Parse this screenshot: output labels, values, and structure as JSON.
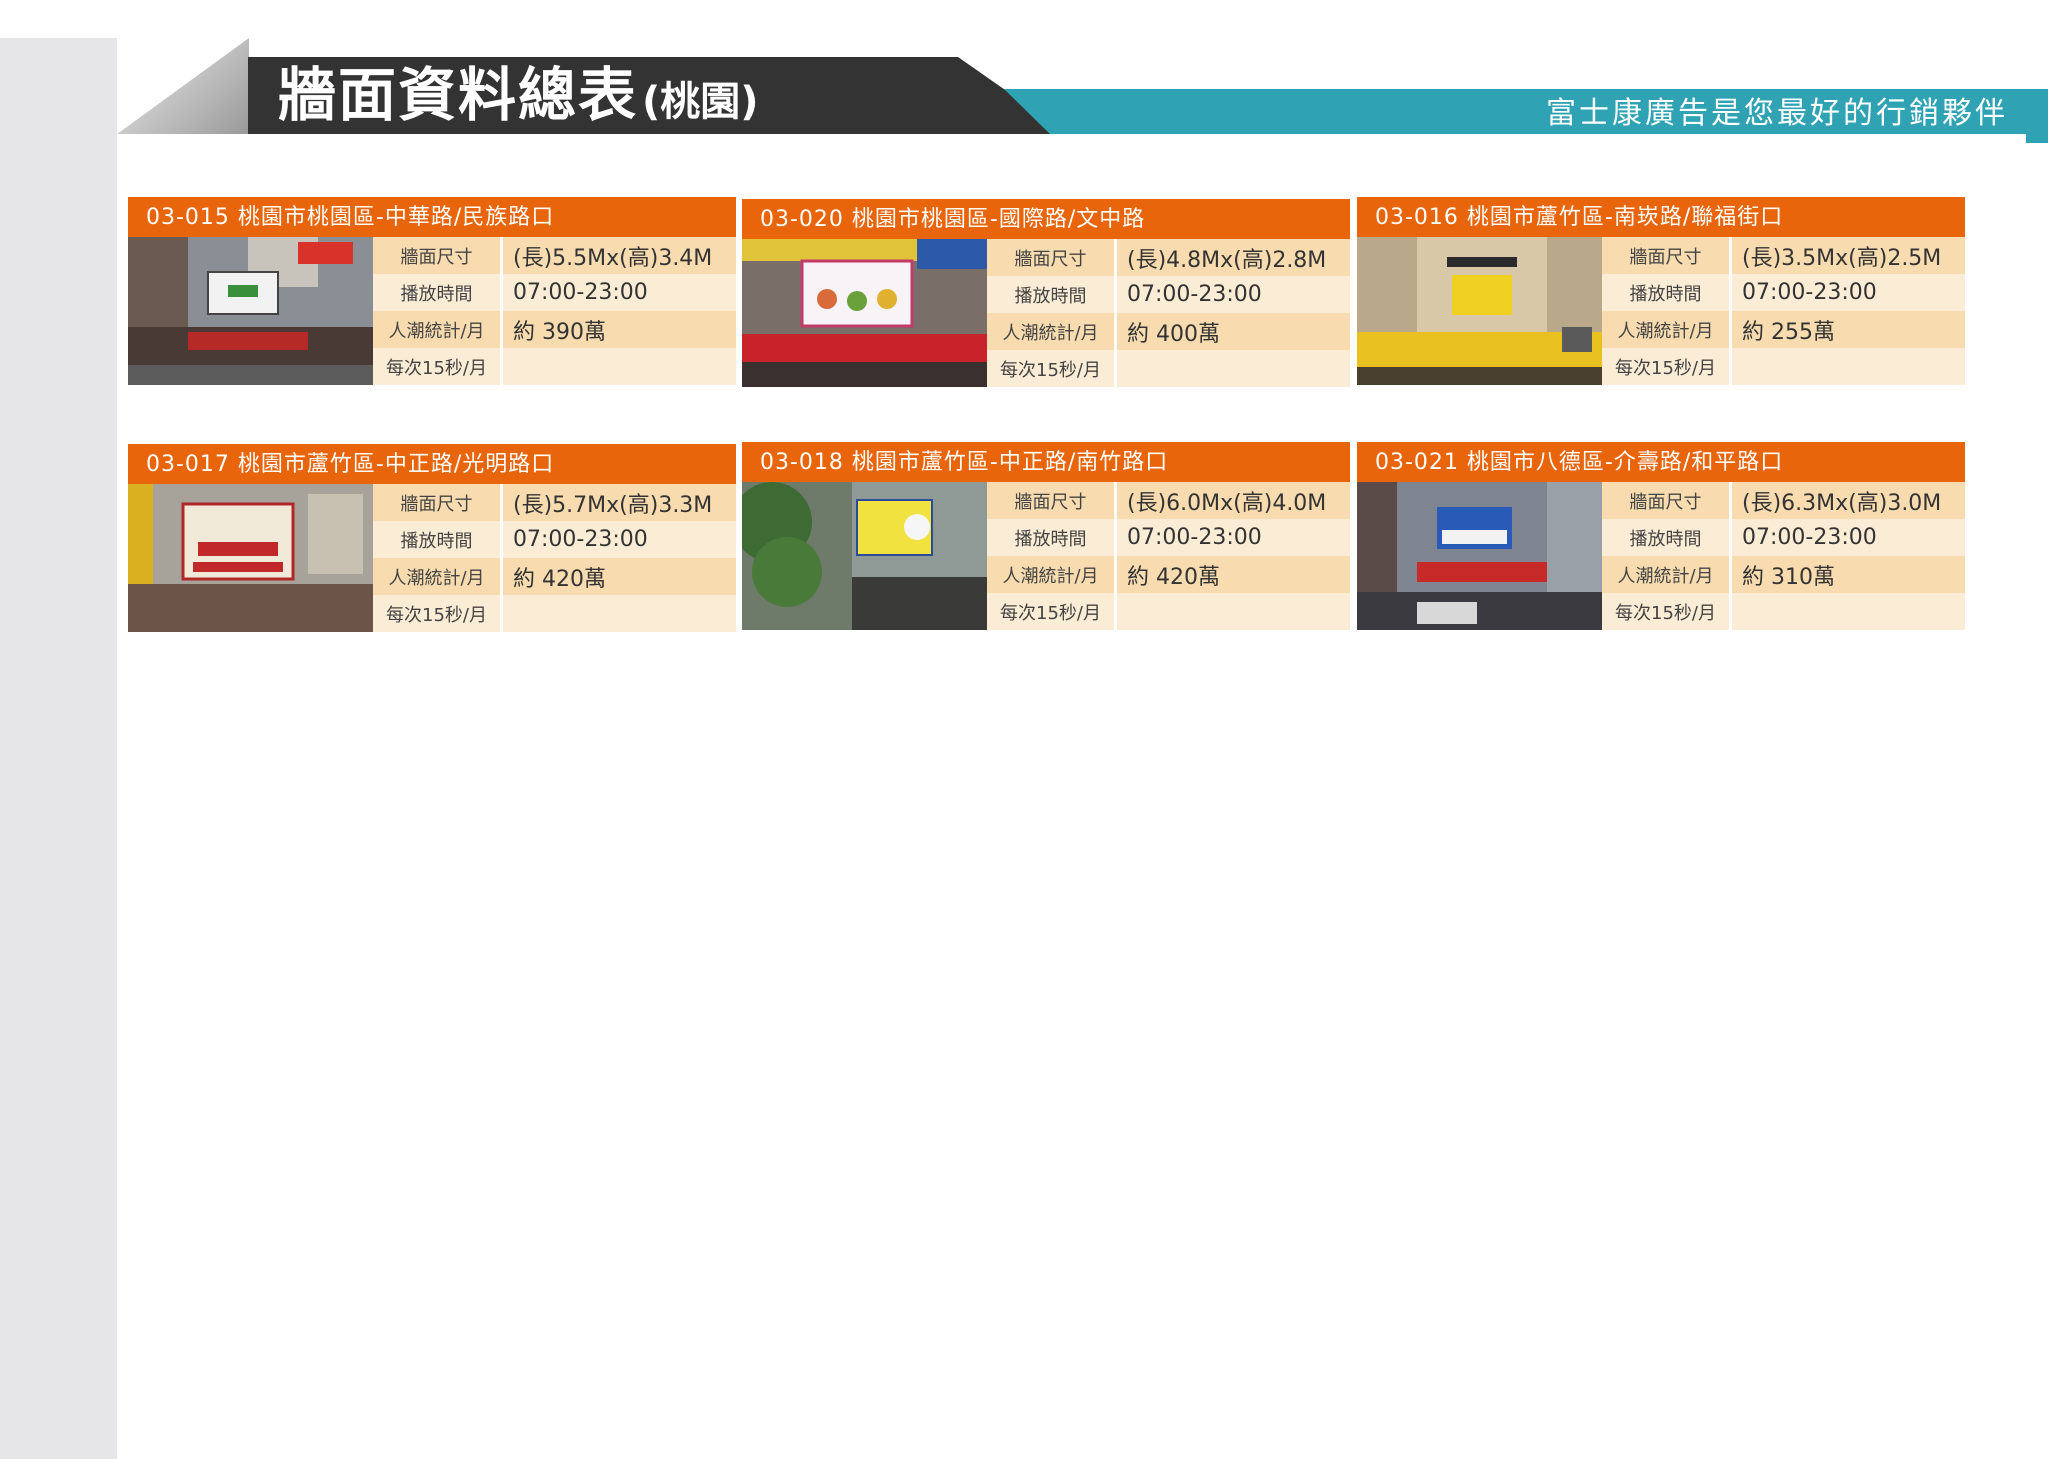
{
  "header": {
    "title": "牆面資料總表",
    "region": "(桃園)",
    "slogan": "富士康廣告是您最好的行銷夥伴"
  },
  "labels": {
    "size": "牆面尺寸",
    "hours": "播放時間",
    "traffic": "人潮統計/月",
    "per15": "每次15秒/月"
  },
  "colors": {
    "header_orange": "#e8650c",
    "title_dark": "#333333",
    "teal": "#2fa3b4",
    "row_dark": "#f8dcb0",
    "row_light": "#fbecd5"
  },
  "listings": [
    {
      "title": "03-015 桃園市桃園區-中華路/民族路口",
      "size": "(長)5.5Mx(高)3.4M",
      "hours": "07:00-23:00",
      "traffic": "約 390萬",
      "per15": ""
    },
    {
      "title": "03-020 桃園市桃園區-國際路/文中路",
      "size": "(長)4.8Mx(高)2.8M",
      "hours": "07:00-23:00",
      "traffic": "約 400萬",
      "per15": ""
    },
    {
      "title": "03-016 桃園市蘆竹區-南崁路/聯福街口",
      "size": "(長)3.5Mx(高)2.5M",
      "hours": "07:00-23:00",
      "traffic": "約 255萬",
      "per15": ""
    },
    {
      "title": "03-017 桃園市蘆竹區-中正路/光明路口",
      "size": "(長)5.7Mx(高)3.3M",
      "hours": "07:00-23:00",
      "traffic": "約 420萬",
      "per15": ""
    },
    {
      "title": "03-018 桃園市蘆竹區-中正路/南竹路口",
      "size": "(長)6.0Mx(高)4.0M",
      "hours": "07:00-23:00",
      "traffic": "約 420萬",
      "per15": ""
    },
    {
      "title": "03-021 桃園市八德區-介壽路/和平路口",
      "size": "(長)6.3Mx(高)3.0M",
      "hours": "07:00-23:00",
      "traffic": "約 310萬",
      "per15": ""
    }
  ]
}
